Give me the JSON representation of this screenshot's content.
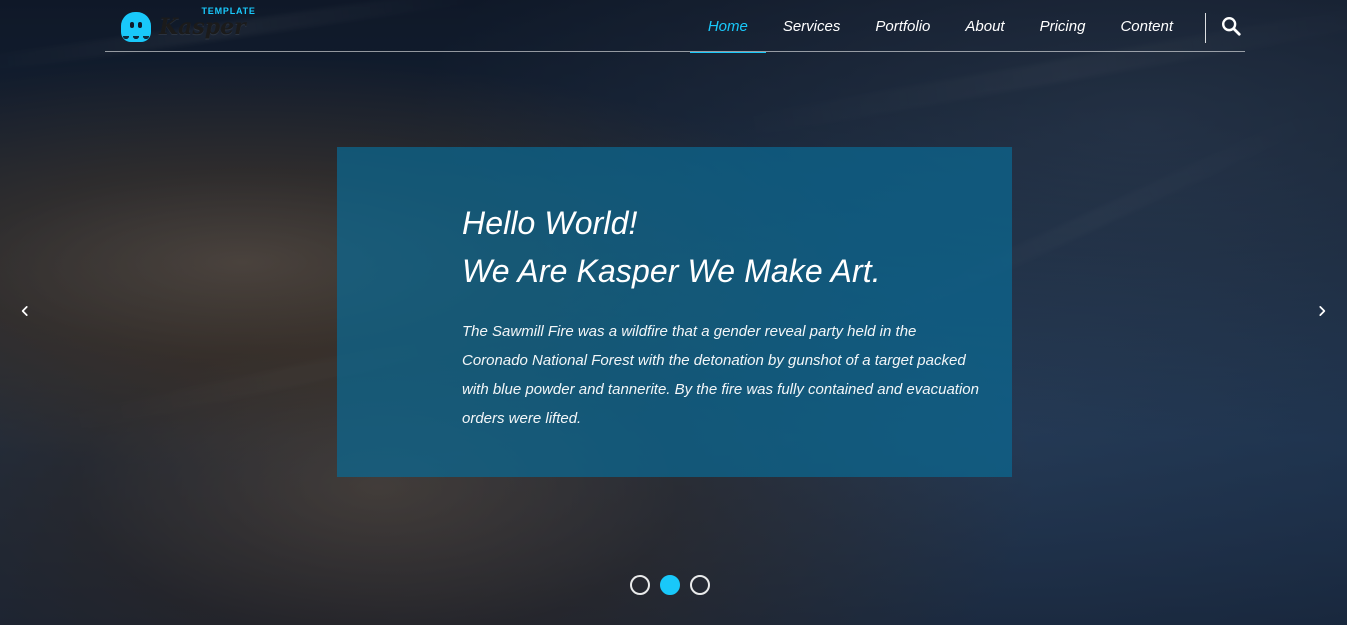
{
  "brand": {
    "template_label": "TEMPLATE",
    "name": "Kasper"
  },
  "nav": {
    "items": [
      {
        "label": "Home",
        "active": true
      },
      {
        "label": "Services",
        "active": false
      },
      {
        "label": "Portfolio",
        "active": false
      },
      {
        "label": "About",
        "active": false
      },
      {
        "label": "Pricing",
        "active": false
      },
      {
        "label": "Content",
        "active": false
      }
    ],
    "search_icon": "search-icon"
  },
  "hero": {
    "headline_line1": "Hello World!",
    "headline_line2": "We Are Kasper We Make Art.",
    "description": "The Sawmill Fire was a wildfire that a gender reveal party held in the Coronado National Forest with the detonation by gunshot of a target packed with blue powder and tannerite. By the fire was fully contained and evacuation orders were lifted."
  },
  "carousel": {
    "left_arrow_icon": "chevron-left-icon",
    "right_arrow_icon": "chevron-right-icon",
    "dots": [
      {
        "active": false
      },
      {
        "active": true
      },
      {
        "active": false
      }
    ]
  },
  "colors": {
    "accent": "#19c8fa",
    "panel_bg": "#0b6891"
  }
}
